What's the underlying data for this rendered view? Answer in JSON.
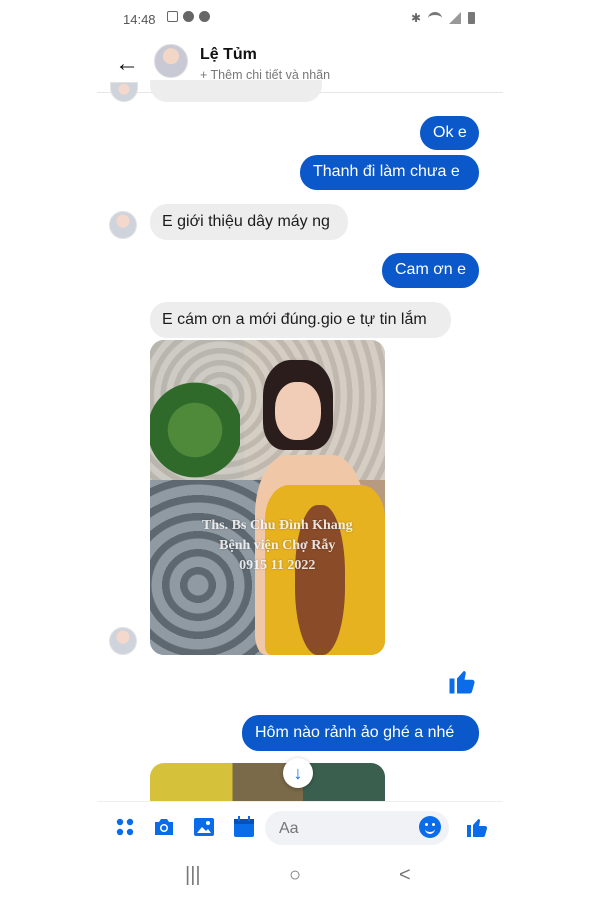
{
  "status_bar": {
    "time": "14:48"
  },
  "header": {
    "contact_name": "Lệ Tủm",
    "subtitle": "+ Thêm chi tiết và nhãn"
  },
  "messages": [
    {
      "sender": "me",
      "text": "Ok e"
    },
    {
      "sender": "me",
      "text": "Thanh đi làm chưa e"
    },
    {
      "sender": "contact",
      "text": "E giới thiệu dây máy ng"
    },
    {
      "sender": "me",
      "text": "Cam ơn e"
    },
    {
      "sender": "contact",
      "text": "E cám ơn a mới đúng.gio e tự tin lắm"
    },
    {
      "sender": "contact",
      "type": "photo"
    },
    {
      "sender": "me",
      "type": "like"
    },
    {
      "sender": "me",
      "text": "Hôm nào rảnh ảo ghé a nhé"
    },
    {
      "sender": "contact",
      "type": "photo"
    }
  ],
  "watermark": {
    "line1": "Ths. Bs Chu Đình Khang",
    "line2": "Bệnh viện Chợ Rẫy",
    "line3": "0915 11 2022"
  },
  "composer": {
    "placeholder": "Aa"
  },
  "icons": {
    "back": "arrow-left-icon",
    "apps": "grid-dots-icon",
    "camera": "camera-icon",
    "gallery": "image-icon",
    "calendar": "calendar-icon",
    "emoji": "emoji-icon",
    "like": "thumbs-up-icon",
    "scroll": "arrow-down-icon"
  },
  "colors": {
    "accent": "#0a58c9",
    "incoming_bubble": "#ededed"
  }
}
